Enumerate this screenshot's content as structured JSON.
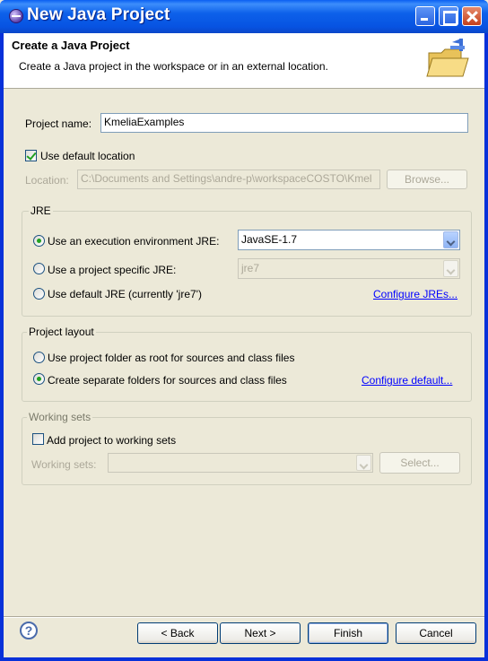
{
  "window": {
    "title": "New Java Project"
  },
  "header": {
    "title": "Create a Java Project",
    "description": "Create a Java project in the workspace or in an external location.",
    "banner_icon": "java-project-folder-icon"
  },
  "project_name": {
    "label": "Project name:",
    "value": "KmeliaExamples"
  },
  "location": {
    "use_default_label": "Use default location",
    "use_default_checked": true,
    "label": "Location:",
    "value": "C:\\Documents and Settings\\andre-p\\workspaceCOSTO\\Kmel",
    "browse_label": "Browse..."
  },
  "jre": {
    "group_title": "JRE",
    "options": [
      {
        "label": "Use an execution environment JRE:",
        "selected": true
      },
      {
        "label": "Use a project specific JRE:",
        "selected": false
      },
      {
        "label": "Use default JRE (currently 'jre7')",
        "selected": false
      }
    ],
    "env_value": "JavaSE-1.7",
    "specific_value": "jre7",
    "configure_link": "Configure JREs..."
  },
  "project_layout": {
    "group_title": "Project layout",
    "options": [
      {
        "label": "Use project folder as root for sources and class files",
        "selected": false
      },
      {
        "label": "Create separate folders for sources and class files",
        "selected": true
      }
    ],
    "configure_link": "Configure default..."
  },
  "working_sets": {
    "group_title": "Working sets",
    "add_label": "Add project to working sets",
    "add_checked": false,
    "sets_label": "Working sets:",
    "select_label": "Select..."
  },
  "footer": {
    "back": "< Back",
    "next": "Next >",
    "finish": "Finish",
    "cancel": "Cancel"
  }
}
